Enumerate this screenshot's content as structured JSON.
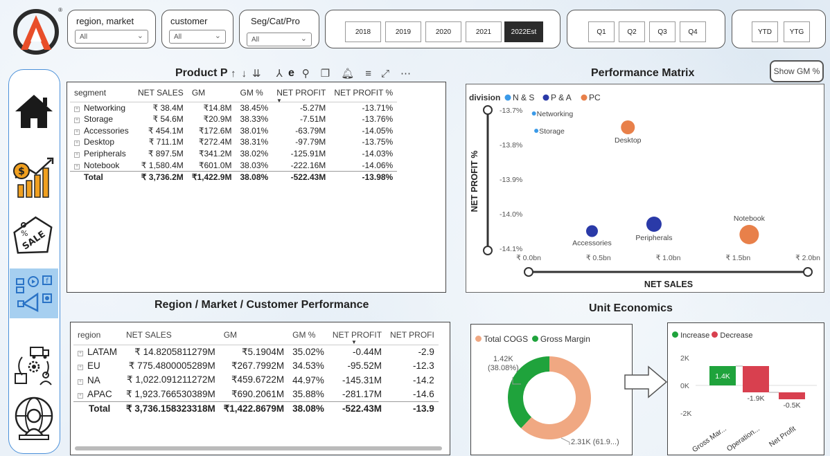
{
  "logo_mark": "A",
  "filters": [
    {
      "label": "region, market",
      "value": "All"
    },
    {
      "label": "customer",
      "value": "All"
    },
    {
      "label": "Seg/Cat/Pro",
      "value": "All"
    }
  ],
  "years": [
    "2018",
    "2019",
    "2020",
    "2021",
    "2022Est"
  ],
  "selected_year": "2022Est",
  "quarters": [
    "Q1",
    "Q2",
    "Q3",
    "Q4"
  ],
  "ytd": [
    "YTD",
    "YTG"
  ],
  "nav": [
    {
      "name": "home",
      "icon": "home-icon"
    },
    {
      "name": "finance",
      "icon": "finance-growth-icon"
    },
    {
      "name": "sales",
      "icon": "sale-tag-icon"
    },
    {
      "name": "marketing",
      "icon": "marketing-icon"
    },
    {
      "name": "supply-chain",
      "icon": "supply-chain-icon"
    },
    {
      "name": "executive",
      "icon": "executive-icon"
    }
  ],
  "product_table": {
    "title_left": "Product P",
    "title_right": "e",
    "columns": [
      "segment",
      "NET SALES",
      "GM",
      "GM %",
      "NET PROFIT",
      "NET PROFIT %"
    ],
    "rows": [
      [
        "Networking",
        "₹ 38.4M",
        "₹14.8M",
        "38.45%",
        "-5.27M",
        "-13.71%"
      ],
      [
        "Storage",
        "₹ 54.6M",
        "₹20.9M",
        "38.33%",
        "-7.51M",
        "-13.76%"
      ],
      [
        "Accessories",
        "₹ 454.1M",
        "₹172.6M",
        "38.01%",
        "-63.79M",
        "-14.05%"
      ],
      [
        "Desktop",
        "₹ 711.1M",
        "₹272.4M",
        "38.31%",
        "-97.79M",
        "-13.75%"
      ],
      [
        "Peripherals",
        "₹ 897.5M",
        "₹341.2M",
        "38.02%",
        "-125.91M",
        "-14.03%"
      ],
      [
        "Notebook",
        "₹ 1,580.4M",
        "₹601.0M",
        "38.03%",
        "-222.16M",
        "-14.06%"
      ]
    ],
    "total": [
      "Total",
      "₹ 3,736.2M",
      "₹1,422.9M",
      "38.08%",
      "-522.43M",
      "-13.98%"
    ]
  },
  "perf_matrix": {
    "title": "Performance Matrix",
    "show_gm_label": "Show GM %",
    "legend_title": "division",
    "legend": [
      {
        "name": "N & S",
        "color": "#3b9ae8"
      },
      {
        "name": "P & A",
        "color": "#2a3aa8"
      },
      {
        "name": "PC",
        "color": "#e8804a"
      }
    ],
    "xlabel": "NET SALES",
    "ylabel": "NET PROFIT %",
    "x_ticks": [
      "₹ 0.0bn",
      "₹ 0.5bn",
      "₹ 1.0bn",
      "₹ 1.5bn",
      "₹ 2.0bn"
    ],
    "y_ticks": [
      "-13.7%",
      "-13.8%",
      "-13.9%",
      "-14.0%",
      "-14.1%"
    ]
  },
  "region_table": {
    "title": "Region / Market / Customer  Performance",
    "columns": [
      "region",
      "NET SALES",
      "GM",
      "GM %",
      "NET PROFIT",
      "NET PROFI"
    ],
    "rows": [
      [
        "LATAM",
        "₹ 14.8205811279M",
        "₹5.1904M",
        "35.02%",
        "-0.44M",
        "-2.9"
      ],
      [
        "EU",
        "₹ 775.4800005289M",
        "₹267.7992M",
        "34.53%",
        "-95.52M",
        "-12.3"
      ],
      [
        "NA",
        "₹ 1,022.091211272M",
        "₹459.6722M",
        "44.97%",
        "-145.31M",
        "-14.2"
      ],
      [
        "APAC",
        "₹ 1,923.766530389M",
        "₹690.2061M",
        "35.88%",
        "-281.17M",
        "-14.6"
      ]
    ],
    "total": [
      "Total",
      "₹ 3,736.158323318M",
      "₹1,422.8679M",
      "38.08%",
      "-522.43M",
      "-13.9"
    ]
  },
  "unit_econ": {
    "title": "Unit Economics",
    "donut_legend": [
      {
        "name": "Total COGS",
        "color": "#f0a882"
      },
      {
        "name": "Gross Margin",
        "color": "#1fa33c"
      }
    ],
    "donut_label_gm": "1.42K",
    "donut_label_gm_pct": "(38.08%)",
    "donut_label_cogs": "2.31K (61.9...)",
    "wf_legend": [
      {
        "name": "Increase",
        "color": "#1fa33c"
      },
      {
        "name": "Decrease",
        "color": "#d8404f"
      }
    ],
    "wf_y_ticks": [
      "2K",
      "0K",
      "-2K"
    ],
    "wf_categories": [
      "Gross Mar...",
      "Operation...",
      "Net Profit"
    ],
    "wf_labels": [
      "1.4K",
      "-1.9K",
      "-0.5K"
    ]
  },
  "chart_data": [
    {
      "type": "scatter",
      "title": "Performance Matrix",
      "xlabel": "NET SALES",
      "ylabel": "NET PROFIT %",
      "xlim": [
        0,
        2.0
      ],
      "ylim": [
        -14.1,
        -13.7
      ],
      "points": [
        {
          "label": "Networking",
          "x": 0.038,
          "y": -13.71,
          "series": "N & S",
          "size": 3
        },
        {
          "label": "Storage",
          "x": 0.055,
          "y": -13.76,
          "series": "N & S",
          "size": 3
        },
        {
          "label": "Desktop",
          "x": 0.711,
          "y": -13.75,
          "series": "PC",
          "size": 10
        },
        {
          "label": "Accessories",
          "x": 0.454,
          "y": -14.05,
          "series": "P & A",
          "size": 8.5
        },
        {
          "label": "Peripherals",
          "x": 0.898,
          "y": -14.03,
          "series": "P & A",
          "size": 11
        },
        {
          "label": "Notebook",
          "x": 1.58,
          "y": -14.06,
          "series": "PC",
          "size": 14
        }
      ]
    },
    {
      "type": "pie",
      "categories": [
        "Total COGS",
        "Gross Margin"
      ],
      "values": [
        2.31,
        1.42
      ]
    },
    {
      "type": "bar",
      "categories": [
        "Gross Mar...",
        "Operation...",
        "Net Profit"
      ],
      "values": [
        1.4,
        -1.9,
        -0.5
      ],
      "ylim": [
        -2.5,
        2.5
      ]
    }
  ]
}
